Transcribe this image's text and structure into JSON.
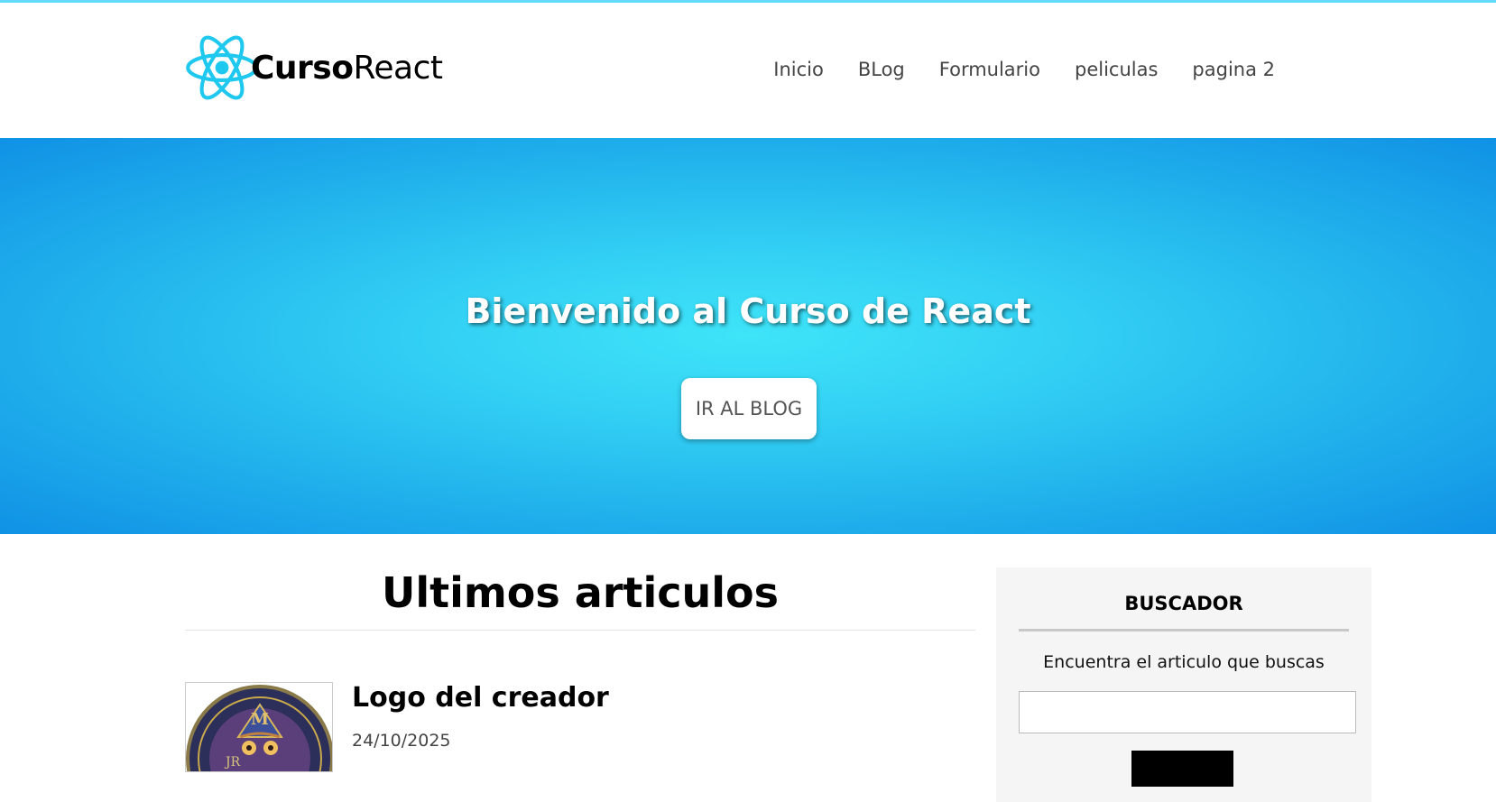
{
  "header": {
    "logo": {
      "bold_text": "Curso",
      "light_text": "React",
      "icon": "react-atom-icon",
      "color": "#1fc8ee"
    },
    "nav": [
      {
        "label": "Inicio"
      },
      {
        "label": "BLog"
      },
      {
        "label": "Formulario"
      },
      {
        "label": "peliculas"
      },
      {
        "label": "pagina 2"
      }
    ]
  },
  "hero": {
    "title": "Bienvenido al Curso de React",
    "button_label": "IR AL BLOG"
  },
  "main": {
    "section_title": "Ultimos articulos",
    "articles": [
      {
        "title": "Logo del creador",
        "date": "24/10/2025",
        "image_icon": "creator-logo-image"
      }
    ]
  },
  "sidebar": {
    "title": "BUSCADOR",
    "description": "Encuentra el articulo que buscas",
    "search_value": "",
    "search_placeholder": ""
  },
  "colors": {
    "accent": "#61dafb",
    "hero_center": "#3ee4f8",
    "hero_edge": "#1091e5"
  }
}
